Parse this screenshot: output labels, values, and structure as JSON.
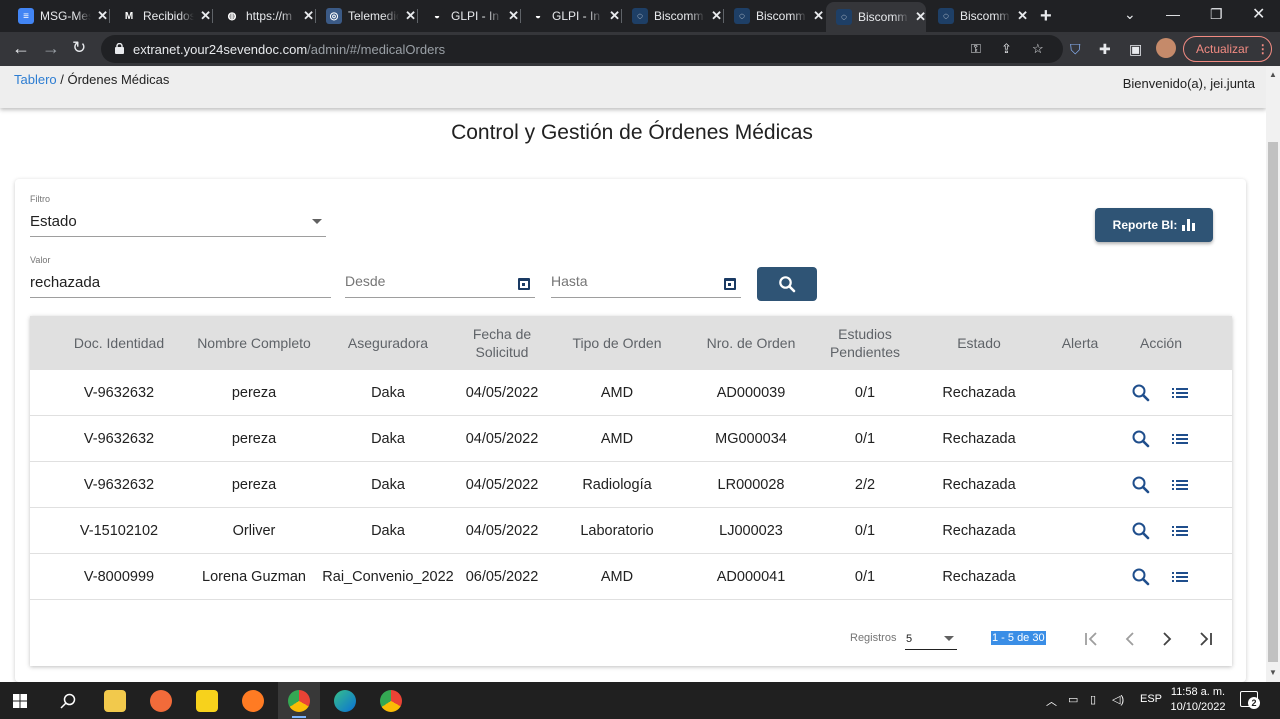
{
  "browser": {
    "tabs": [
      {
        "title": "MSG-Mesa",
        "icon": "docs-icon",
        "color": "#4285f4",
        "glyph": "≡"
      },
      {
        "title": "Recibidos",
        "icon": "gmail-icon",
        "color": "#202124",
        "glyph": "M"
      },
      {
        "title": "https://m",
        "icon": "globe-icon",
        "color": "#202124",
        "glyph": "◍"
      },
      {
        "title": "Telemedicina",
        "icon": "telemed-icon",
        "color": "#3b5a86",
        "glyph": "◎"
      },
      {
        "title": "GLPI - In",
        "icon": "glpi-icon",
        "color": "#202124",
        "glyph": "◒"
      },
      {
        "title": "GLPI - In",
        "icon": "glpi-icon",
        "color": "#202124",
        "glyph": "◒"
      },
      {
        "title": "Biscomm",
        "icon": "biscomm-icon",
        "color": "#1e3f66",
        "glyph": "◌"
      },
      {
        "title": "Biscomm",
        "icon": "biscomm-icon",
        "color": "#1e3f66",
        "glyph": "◌"
      },
      {
        "title": "Biscomm",
        "icon": "biscomm-icon",
        "color": "#1e3f66",
        "glyph": "◌"
      },
      {
        "title": "Biscomm",
        "icon": "biscomm-icon",
        "color": "#1e3f66",
        "glyph": "◌"
      }
    ],
    "url_host": "extranet.your24sevendoc.com",
    "url_path": "/admin/#/medicalOrders",
    "update_label": "Actualizar"
  },
  "header": {
    "breadcrumb_link": "Tablero",
    "breadcrumb_sep": " / ",
    "breadcrumb_current": "Órdenes Médicas",
    "welcome": "Bienvenido(a), jei.junta"
  },
  "page_title": "Control y Gestión de Órdenes Médicas",
  "filters": {
    "filter_label": "Filtro",
    "filter_value": "Estado",
    "value_label": "Valor",
    "value_value": "rechazada",
    "from_placeholder": "Desde",
    "to_placeholder": "Hasta",
    "report_label": "Reporte BI:"
  },
  "table": {
    "headers": [
      "Doc. Identidad",
      "Nombre Completo",
      "Aseguradora",
      "Fecha de Solicitud",
      "Tipo de Orden",
      "Nro. de Orden",
      "Estudios Pendientes",
      "Estado",
      "Alerta",
      "Acción"
    ],
    "rows": [
      [
        "V-9632632",
        "pereza",
        "Daka",
        "04/05/2022",
        "AMD",
        "AD000039",
        "0/1",
        "Rechazada",
        ""
      ],
      [
        "V-9632632",
        "pereza",
        "Daka",
        "04/05/2022",
        "AMD",
        "MG000034",
        "0/1",
        "Rechazada",
        ""
      ],
      [
        "V-9632632",
        "pereza",
        "Daka",
        "04/05/2022",
        "Radiología",
        "LR000028",
        "2/2",
        "Rechazada",
        ""
      ],
      [
        "V-15102102",
        "Orliver",
        "Daka",
        "04/05/2022",
        "Laboratorio",
        "LJ000023",
        "0/1",
        "Rechazada",
        ""
      ],
      [
        "V-8000999",
        "Lorena Guzman",
        "Rai_Convenio_2022",
        "06/05/2022",
        "AMD",
        "AD000041",
        "0/1",
        "Rechazada",
        ""
      ]
    ]
  },
  "pagination": {
    "label": "Registros",
    "page_size": "5",
    "range": "1 - 5 de 30"
  },
  "taskbar": {
    "lang": "ESP",
    "time": "11:58 a. m.",
    "date": "10/10/2022",
    "notifications": "2"
  }
}
